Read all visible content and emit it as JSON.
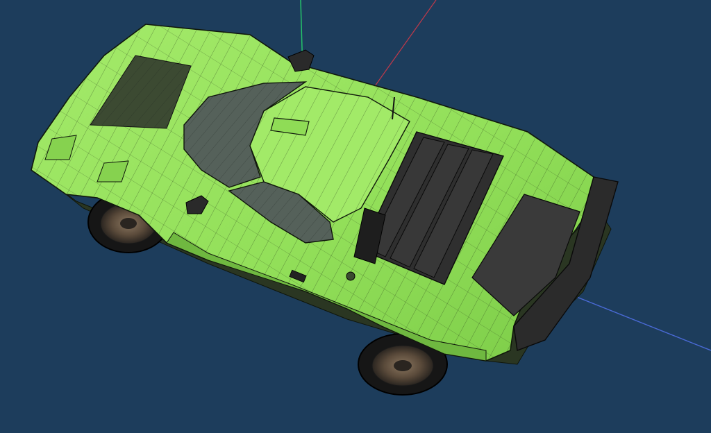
{
  "viewport": {
    "background": "#1d3d5c",
    "projection": "perspective",
    "render_mode": "shaded-with-wireframe-edges"
  },
  "axes": {
    "x_color": "#c0394a",
    "y_color": "#25c46a",
    "z_color": "#4a6ad6"
  },
  "model": {
    "subject": "sports-car",
    "body_color": "#93e05a",
    "body_highlight": "#a9ee6c",
    "body_shadow": "#6fb840",
    "edge_color": "#111a0e",
    "glass_color": "#4e5a55",
    "trim_color": "#2b2b2b",
    "tire_color": "#1a1a1a",
    "rim_color": "#6b5a48"
  }
}
